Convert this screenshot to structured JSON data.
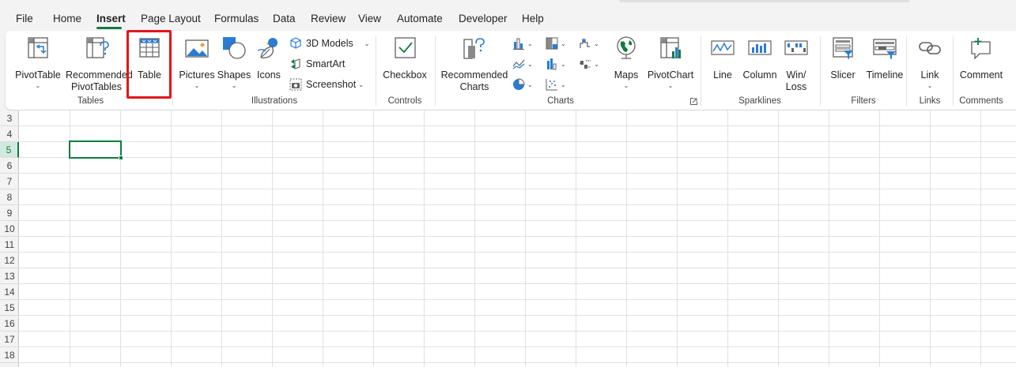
{
  "menu": {
    "tabs": [
      "File",
      "Home",
      "Insert",
      "Page Layout",
      "Formulas",
      "Data",
      "Review",
      "View",
      "Automate",
      "Developer",
      "Help"
    ],
    "active_tab": "Insert"
  },
  "ribbon": {
    "tables": {
      "group_label": "Tables",
      "pivottable_label": "PivotTable",
      "recommended_pivot_line1": "Recommended",
      "recommended_pivot_line2": "PivotTables",
      "table_label": "Table"
    },
    "illustrations": {
      "group_label": "Illustrations",
      "pictures_label": "Pictures",
      "shapes_label": "Shapes",
      "icons_label": "Icons",
      "models_label": "3D Models",
      "smartart_label": "SmartArt",
      "screenshot_label": "Screenshot"
    },
    "controls": {
      "group_label": "Controls",
      "checkbox_label": "Checkbox"
    },
    "charts": {
      "group_label": "Charts",
      "recommended_line1": "Recommended",
      "recommended_line2": "Charts",
      "maps_label": "Maps",
      "pivotchart_label": "PivotChart"
    },
    "sparklines": {
      "group_label": "Sparklines",
      "line_label": "Line",
      "column_label": "Column",
      "winloss_line1": "Win/",
      "winloss_line2": "Loss"
    },
    "filters": {
      "group_label": "Filters",
      "slicer_label": "Slicer",
      "timeline_label": "Timeline"
    },
    "links": {
      "group_label": "Links",
      "link_label": "Link"
    },
    "comments": {
      "group_label": "Comments",
      "comment_label": "Comment"
    }
  },
  "sheet": {
    "row_numbers": [
      "3",
      "4",
      "5",
      "6",
      "7",
      "8",
      "9",
      "10",
      "11",
      "12",
      "13",
      "14",
      "15",
      "16",
      "17",
      "18"
    ],
    "selected_row": "5"
  },
  "colors": {
    "accent_green": "#107c41",
    "highlight_red": "#e0161b"
  }
}
